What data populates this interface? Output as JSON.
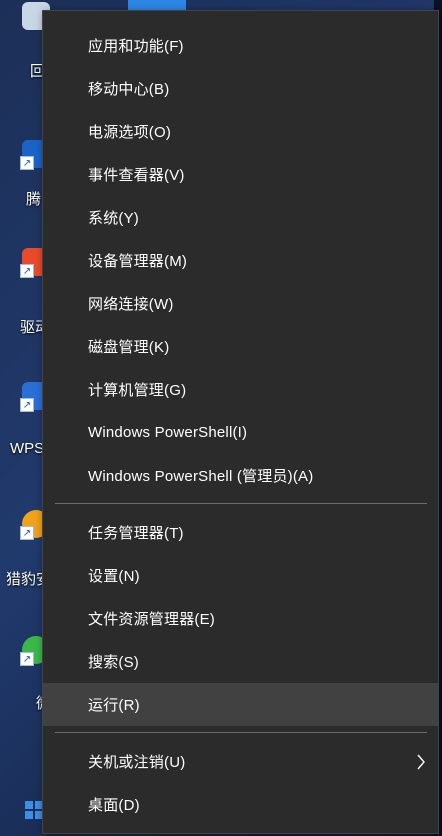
{
  "desktop": {
    "icons": [
      {
        "label": "回"
      },
      {
        "label": "腾"
      },
      {
        "label": "驱动"
      },
      {
        "label": "WPS"
      },
      {
        "label": "猎豹安"
      },
      {
        "label": "微"
      }
    ]
  },
  "menu": {
    "items": [
      {
        "label": "应用和功能(F)"
      },
      {
        "label": "移动中心(B)"
      },
      {
        "label": "电源选项(O)"
      },
      {
        "label": "事件查看器(V)"
      },
      {
        "label": "系统(Y)"
      },
      {
        "label": "设备管理器(M)"
      },
      {
        "label": "网络连接(W)"
      },
      {
        "label": "磁盘管理(K)"
      },
      {
        "label": "计算机管理(G)"
      },
      {
        "label": "Windows PowerShell(I)"
      },
      {
        "label": "Windows PowerShell (管理员)(A)"
      },
      {
        "label": "任务管理器(T)"
      },
      {
        "label": "设置(N)"
      },
      {
        "label": "文件资源管理器(E)"
      },
      {
        "label": "搜索(S)"
      },
      {
        "label": "运行(R)"
      },
      {
        "label": "关机或注销(U)"
      },
      {
        "label": "桌面(D)"
      }
    ]
  }
}
